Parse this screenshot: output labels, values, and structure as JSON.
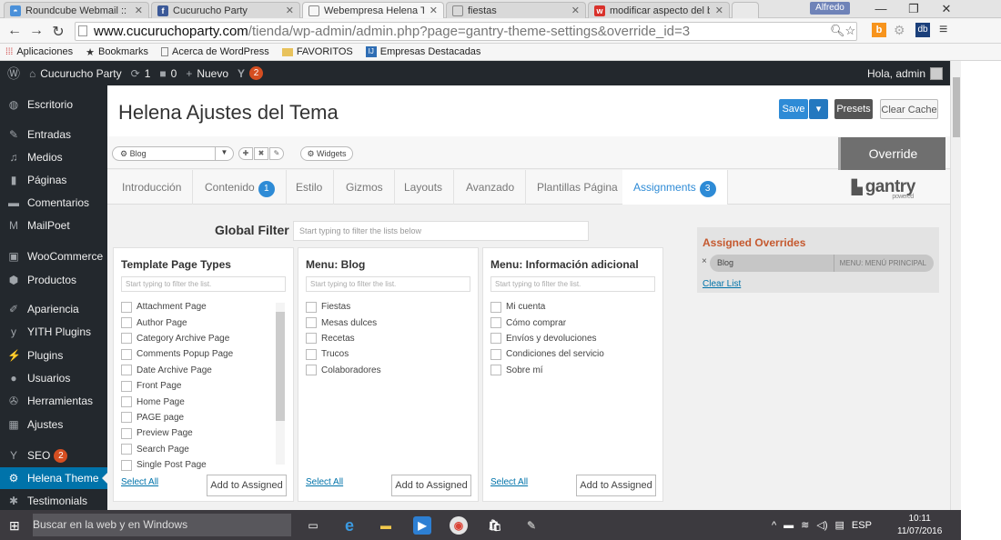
{
  "browser": {
    "tabs": [
      {
        "title": "Roundcube Webmail :: En",
        "icon": "roundcube-icon",
        "color": "#4a90d9"
      },
      {
        "title": "Cucurucho Party",
        "icon": "facebook-icon",
        "color": "#3b5998"
      },
      {
        "title": "Webempresa Helena The",
        "icon": "page-icon",
        "color": "#888888"
      },
      {
        "title": "fiestas",
        "icon": "page-icon",
        "color": "#888888"
      },
      {
        "title": "modificar aspecto del blo",
        "icon": "webempresa-icon",
        "color": "#d9312b"
      }
    ],
    "user": "Alfredo",
    "url_host": "www.cucuruchoparty.com",
    "url_path": "/tienda/wp-admin/admin.php?page=gantry-theme-settings&override_id=3",
    "bookmarks": [
      "Aplicaciones",
      "Bookmarks",
      "Acerca de WordPress",
      "FAVORITOS",
      "Empresas Destacadas"
    ]
  },
  "adminbar": {
    "site": "Cucurucho Party",
    "updates": "1",
    "comments": "0",
    "new": "Nuevo",
    "seo_badge": "2",
    "greeting": "Hola, admin"
  },
  "sidebar": {
    "items": [
      {
        "label": "Escritorio",
        "icon": "dashboard-icon"
      },
      {
        "label": "Entradas",
        "icon": "pin-icon"
      },
      {
        "label": "Medios",
        "icon": "media-icon"
      },
      {
        "label": "Páginas",
        "icon": "pages-icon"
      },
      {
        "label": "Comentarios",
        "icon": "comments-icon"
      },
      {
        "label": "MailPoet",
        "icon": "mailpoet-icon"
      },
      {
        "label": "WooCommerce",
        "icon": "woocommerce-icon"
      },
      {
        "label": "Productos",
        "icon": "products-icon"
      },
      {
        "label": "Apariencia",
        "icon": "appearance-icon"
      },
      {
        "label": "YITH Plugins",
        "icon": "yith-icon"
      },
      {
        "label": "Plugins",
        "icon": "plugins-icon"
      },
      {
        "label": "Usuarios",
        "icon": "users-icon"
      },
      {
        "label": "Herramientas",
        "icon": "tools-icon"
      },
      {
        "label": "Ajustes",
        "icon": "settings-icon"
      },
      {
        "label": "SEO",
        "icon": "seo-icon",
        "badge": "2"
      },
      {
        "label": "Helena Theme",
        "icon": "gear-icon"
      },
      {
        "label": "Testimonials",
        "icon": "testimonials-icon"
      }
    ]
  },
  "page": {
    "title": "Helena Ajustes del Tema",
    "save": "Save",
    "presets": "Presets",
    "clear_cache": "Clear Cache",
    "blog_select": "Blog",
    "widgets": "Widgets",
    "override": "Override",
    "tabs": [
      {
        "label": "Introducción"
      },
      {
        "label": "Contenido",
        "count": "1"
      },
      {
        "label": "Estilo"
      },
      {
        "label": "Gizmos"
      },
      {
        "label": "Layouts"
      },
      {
        "label": "Avanzado"
      },
      {
        "label": "Plantillas Página"
      },
      {
        "label": "Assignments",
        "count": "3"
      }
    ],
    "brand": "gantry",
    "brand_sub": "powered"
  },
  "filter": {
    "label": "Global Filter",
    "placeholder": "Start typing to filter the lists below"
  },
  "panels": [
    {
      "title": "Template Page Types",
      "placeholder": "Start typing to filter the list.",
      "items": [
        "Attachment Page",
        "Author Page",
        "Category Archive Page",
        "Comments Popup Page",
        "Date Archive Page",
        "Front Page",
        "Home Page",
        "PAGE page",
        "Preview Page",
        "Search Page",
        "Single Post Page"
      ],
      "select_all": "Select All",
      "add": "Add to Assigned"
    },
    {
      "title": "Menu: Blog",
      "placeholder": "Start typing to filter the list.",
      "items": [
        "Fiestas",
        "Mesas dulces",
        "Recetas",
        "Trucos",
        "Colaboradores"
      ],
      "select_all": "Select All",
      "add": "Add to Assigned"
    },
    {
      "title": "Menu: Información adicional",
      "placeholder": "Start typing to filter the list.",
      "items": [
        "Mi cuenta",
        "Cómo comprar",
        "Envíos y devoluciones",
        "Condiciones del servicio",
        "Sobre mí"
      ],
      "select_all": "Select All",
      "add": "Add to Assigned"
    }
  ],
  "assigned": {
    "title": "Assigned Overrides",
    "item": "Blog",
    "item_menu": "MENU: MENÚ PRINCIPAL",
    "clear": "Clear List"
  },
  "taskbar": {
    "search": "Buscar en la web y en Windows",
    "lang": "ESP",
    "time": "10:11",
    "date": "11/07/2016"
  },
  "colors": {
    "accent": "#2e8bd6",
    "wp_dark": "#23282d",
    "wp_active": "#0073aa",
    "badge": "#d54e21",
    "assigned_title": "#c5592f"
  }
}
